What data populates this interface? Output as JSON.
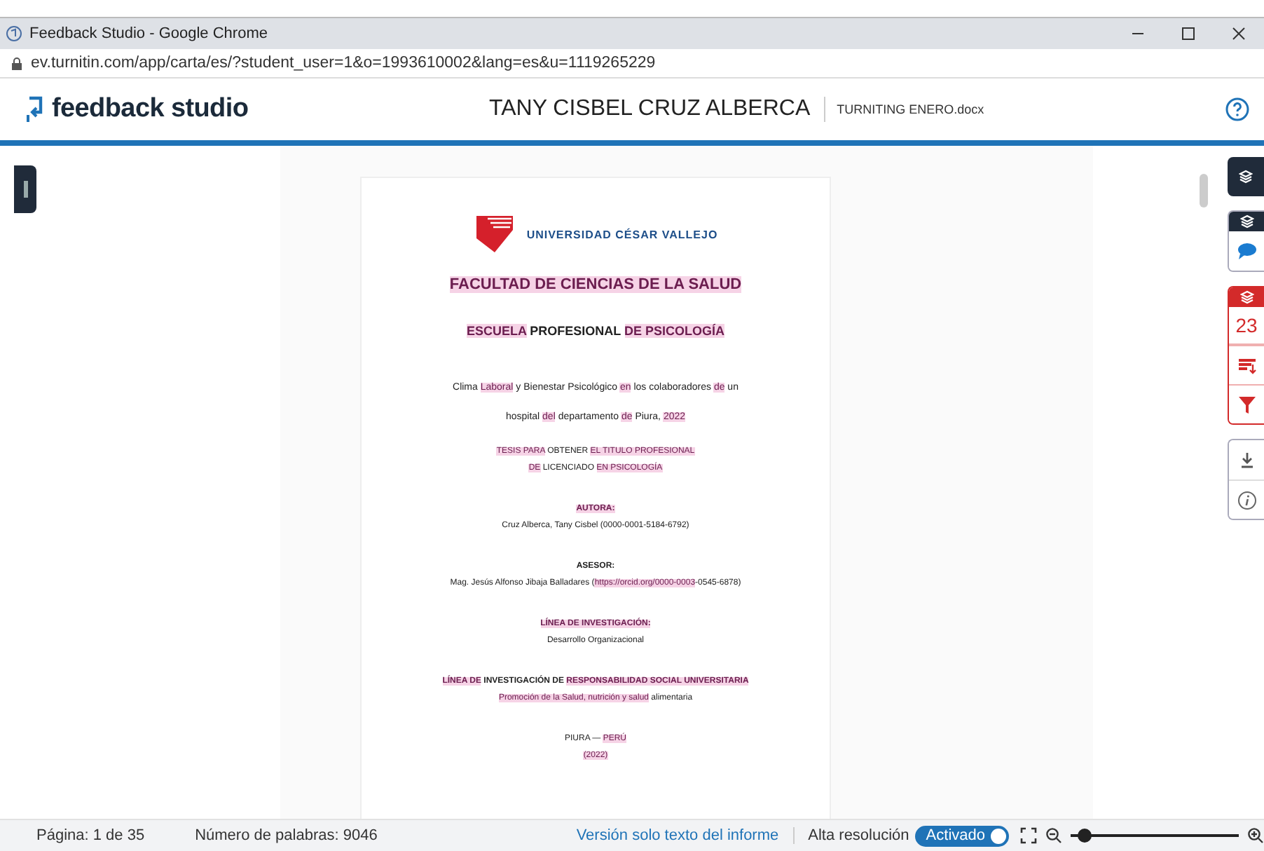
{
  "browser": {
    "title": "Feedback Studio - Google Chrome",
    "url": "ev.turnitin.com/app/carta/es/?student_user=1&o=1993610002&lang=es&u=1119265229"
  },
  "header": {
    "logo": "feedback studio",
    "student": "TANY CISBEL CRUZ ALBERCA",
    "file": "TURNITING ENERO.docx"
  },
  "document": {
    "university": "UNIVERSIDAD CÉSAR VALLEJO",
    "blocks": [
      {
        "lines": [
          {
            "kind": "title",
            "segments": [
              {
                "text": "FACULTAD DE CIENCIAS DE LA SALUD",
                "highlighted": true
              }
            ]
          }
        ]
      },
      {
        "lines": [
          {
            "kind": "heading",
            "segments": [
              {
                "text": "ESCUELA",
                "highlighted": true
              },
              {
                "text": " PROFESIONAL ",
                "highlighted": false
              },
              {
                "text": "DE PSICOLOGÍA",
                "highlighted": true
              }
            ]
          }
        ]
      },
      {
        "lines": [
          {
            "kind": "body",
            "segments": [
              {
                "text": "Clima ",
                "highlighted": false
              },
              {
                "text": "Laboral",
                "highlighted": true
              },
              {
                "text": " y Bienestar Psicológico ",
                "highlighted": false
              },
              {
                "text": "en",
                "highlighted": true
              },
              {
                "text": " los colaboradores ",
                "highlighted": false
              },
              {
                "text": "de",
                "highlighted": true
              },
              {
                "text": " un",
                "highlighted": false
              }
            ]
          },
          {
            "kind": "body",
            "segments": [
              {
                "text": "hospital ",
                "highlighted": false
              },
              {
                "text": "del",
                "highlighted": true
              },
              {
                "text": " departamento ",
                "highlighted": false
              },
              {
                "text": "de",
                "highlighted": true
              },
              {
                "text": " Piura, ",
                "highlighted": false
              },
              {
                "text": "2022",
                "highlighted": true
              }
            ]
          }
        ]
      },
      {
        "lines": [
          {
            "kind": "small",
            "segments": [
              {
                "text": "TESIS PARA",
                "highlighted": true
              },
              {
                "text": " OBTENER ",
                "highlighted": false
              },
              {
                "text": "EL TITULO PROFESIONAL",
                "highlighted": true
              }
            ]
          },
          {
            "kind": "small",
            "segments": [
              {
                "text": "DE",
                "highlighted": true
              },
              {
                "text": " LICENCIADO ",
                "highlighted": false
              },
              {
                "text": "EN PSICOLOGÍA",
                "highlighted": true
              }
            ]
          }
        ]
      },
      {
        "lines": [
          {
            "kind": "label",
            "segments": [
              {
                "text": "AUTORA:",
                "highlighted": true
              }
            ]
          },
          {
            "kind": "small",
            "segments": [
              {
                "text": "Cruz Alberca, Tany Cisbel (0000-0001-5184-6792)",
                "highlighted": false
              }
            ]
          }
        ]
      },
      {
        "lines": [
          {
            "kind": "label",
            "segments": [
              {
                "text": "ASESOR:",
                "highlighted": false
              }
            ]
          },
          {
            "kind": "small",
            "segments": [
              {
                "text": "Mag. Jesús Alfonso Jibaja Balladares (",
                "highlighted": false
              },
              {
                "text": "https://orcid.org/0000-0003",
                "highlighted": true
              },
              {
                "text": "-0545-6878)",
                "highlighted": false
              }
            ]
          }
        ]
      },
      {
        "lines": [
          {
            "kind": "label",
            "segments": [
              {
                "text": "LÍNEA DE INVESTIGACIÓN:",
                "highlighted": true
              }
            ]
          },
          {
            "kind": "small",
            "segments": [
              {
                "text": "Desarrollo Organizacional",
                "highlighted": false
              }
            ]
          }
        ]
      },
      {
        "lines": [
          {
            "kind": "label",
            "segments": [
              {
                "text": "LÍNEA DE",
                "highlighted": true
              },
              {
                "text": " INVESTIGACIÓN DE ",
                "highlighted": false
              },
              {
                "text": "RESPONSABILIDAD SOCIAL UNIVERSITARIA",
                "highlighted": true
              }
            ]
          },
          {
            "kind": "small",
            "segments": [
              {
                "text": "Promoción de la Salud, nutrición y salud",
                "highlighted": true
              },
              {
                "text": " alimentaria",
                "highlighted": false
              }
            ]
          }
        ]
      },
      {
        "lines": [
          {
            "kind": "small",
            "segments": [
              {
                "text": "PIURA — ",
                "highlighted": false
              },
              {
                "text": "PERÚ",
                "highlighted": true
              }
            ]
          },
          {
            "kind": "small",
            "segments": [
              {
                "text": "(2022)",
                "highlighted": true
              }
            ]
          }
        ]
      }
    ]
  },
  "similarity": {
    "score": "23"
  },
  "status_bar": {
    "page": "Página: 1 de 35",
    "words": "Número de palabras: 9046",
    "text_only_link": "Versión solo texto del informe",
    "high_res_label": "Alta resolución",
    "high_res": {
      "label": "Activado",
      "on": true
    },
    "zoom": {
      "level": 0.08
    }
  }
}
